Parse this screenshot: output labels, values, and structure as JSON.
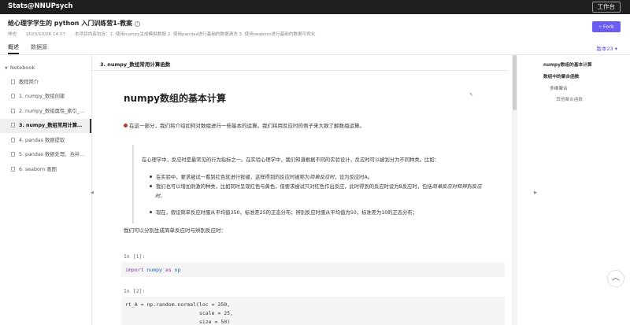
{
  "topbar": {
    "brand": "Stats@NNUPsych",
    "workbench_label": "工作台"
  },
  "project": {
    "title": "给心理学学生的 python 入门训练营1-教案",
    "author": "林也",
    "date": "2023/10/26 14:57",
    "summary": "本项目内容包含：1. 使用numpy生成模拟数据 2. 使用pandas进行基础的数据清洗 3. 使用seaborn进行基础的数据可视化",
    "fork_label": "Fork",
    "accent_color": "#6a5cf2"
  },
  "tabs": [
    {
      "label": "概述",
      "active": true
    },
    {
      "label": "数据源",
      "active": false
    }
  ],
  "version_label": "版本23",
  "notebook": {
    "header": "Notebook",
    "items": [
      {
        "label": "教程简介",
        "active": false
      },
      {
        "label": "1. numpy_数组创建",
        "active": false
      },
      {
        "label": "2. numpy_数组属性_索引_...",
        "active": false
      },
      {
        "label": "3. numpy_数组常用计算函数",
        "active": true
      },
      {
        "label": "4. pandas 数据提取",
        "active": false
      },
      {
        "label": "5. pandas 数据处理、合并...",
        "active": false
      },
      {
        "label": "6. seaborn 画图",
        "active": false
      }
    ]
  },
  "content": {
    "cell_title": "3. numpy_数组常用计算函数",
    "heading": "numpy数组的基本计算",
    "intro": "在这一部分，我们将介绍如何对数组进行一些基本的运算。我们将用反应时的例子来大致了解数组运算。",
    "quote": {
      "p1": "在心理学中，反应时是最常见的行为指标之一。在实验心理学中，我们知道根据不同的实验设计，反应时可以被划分为不同种类。比如：",
      "li1_pre": "在实验中，要求被试一看到红色就进行按键，这样得到的反应时被称为",
      "li1_em": "简单反应时",
      "li1_post": "，设为反应时A。",
      "li2_pre": "我们也可以增加刺激的种类，比如同时呈现红色与黄色，但要求被试只对红色作出反应，此时得到的反应时设为B反应时，包括",
      "li2_em": "简单反应时和辨别反应",
      "li2_cont": "时。",
      "li3": "现在，假设简单反应时服从平均值350，标准差25的正态分布；辨别反应时服从平均值为50，标准差为10的正态分布；"
    },
    "para2": "我们可以分别生成简单反应时与辨别反应时：",
    "cells": [
      {
        "label": "In [1]:",
        "lines": [
          "import numpy as np"
        ]
      },
      {
        "label": "In [2]:",
        "lines": [
          "rt_A = np.random.normal(loc = 350,",
          "                        scale = 25,",
          "                        size = 50)"
        ]
      }
    ]
  },
  "toc": [
    {
      "label": "numpy数组的基本计算",
      "level": 1
    },
    {
      "label": "数组中的聚合函数",
      "level": 1
    },
    {
      "label": "多维聚合",
      "level": 2
    },
    {
      "label": "其他聚合函数",
      "level": 3
    }
  ]
}
